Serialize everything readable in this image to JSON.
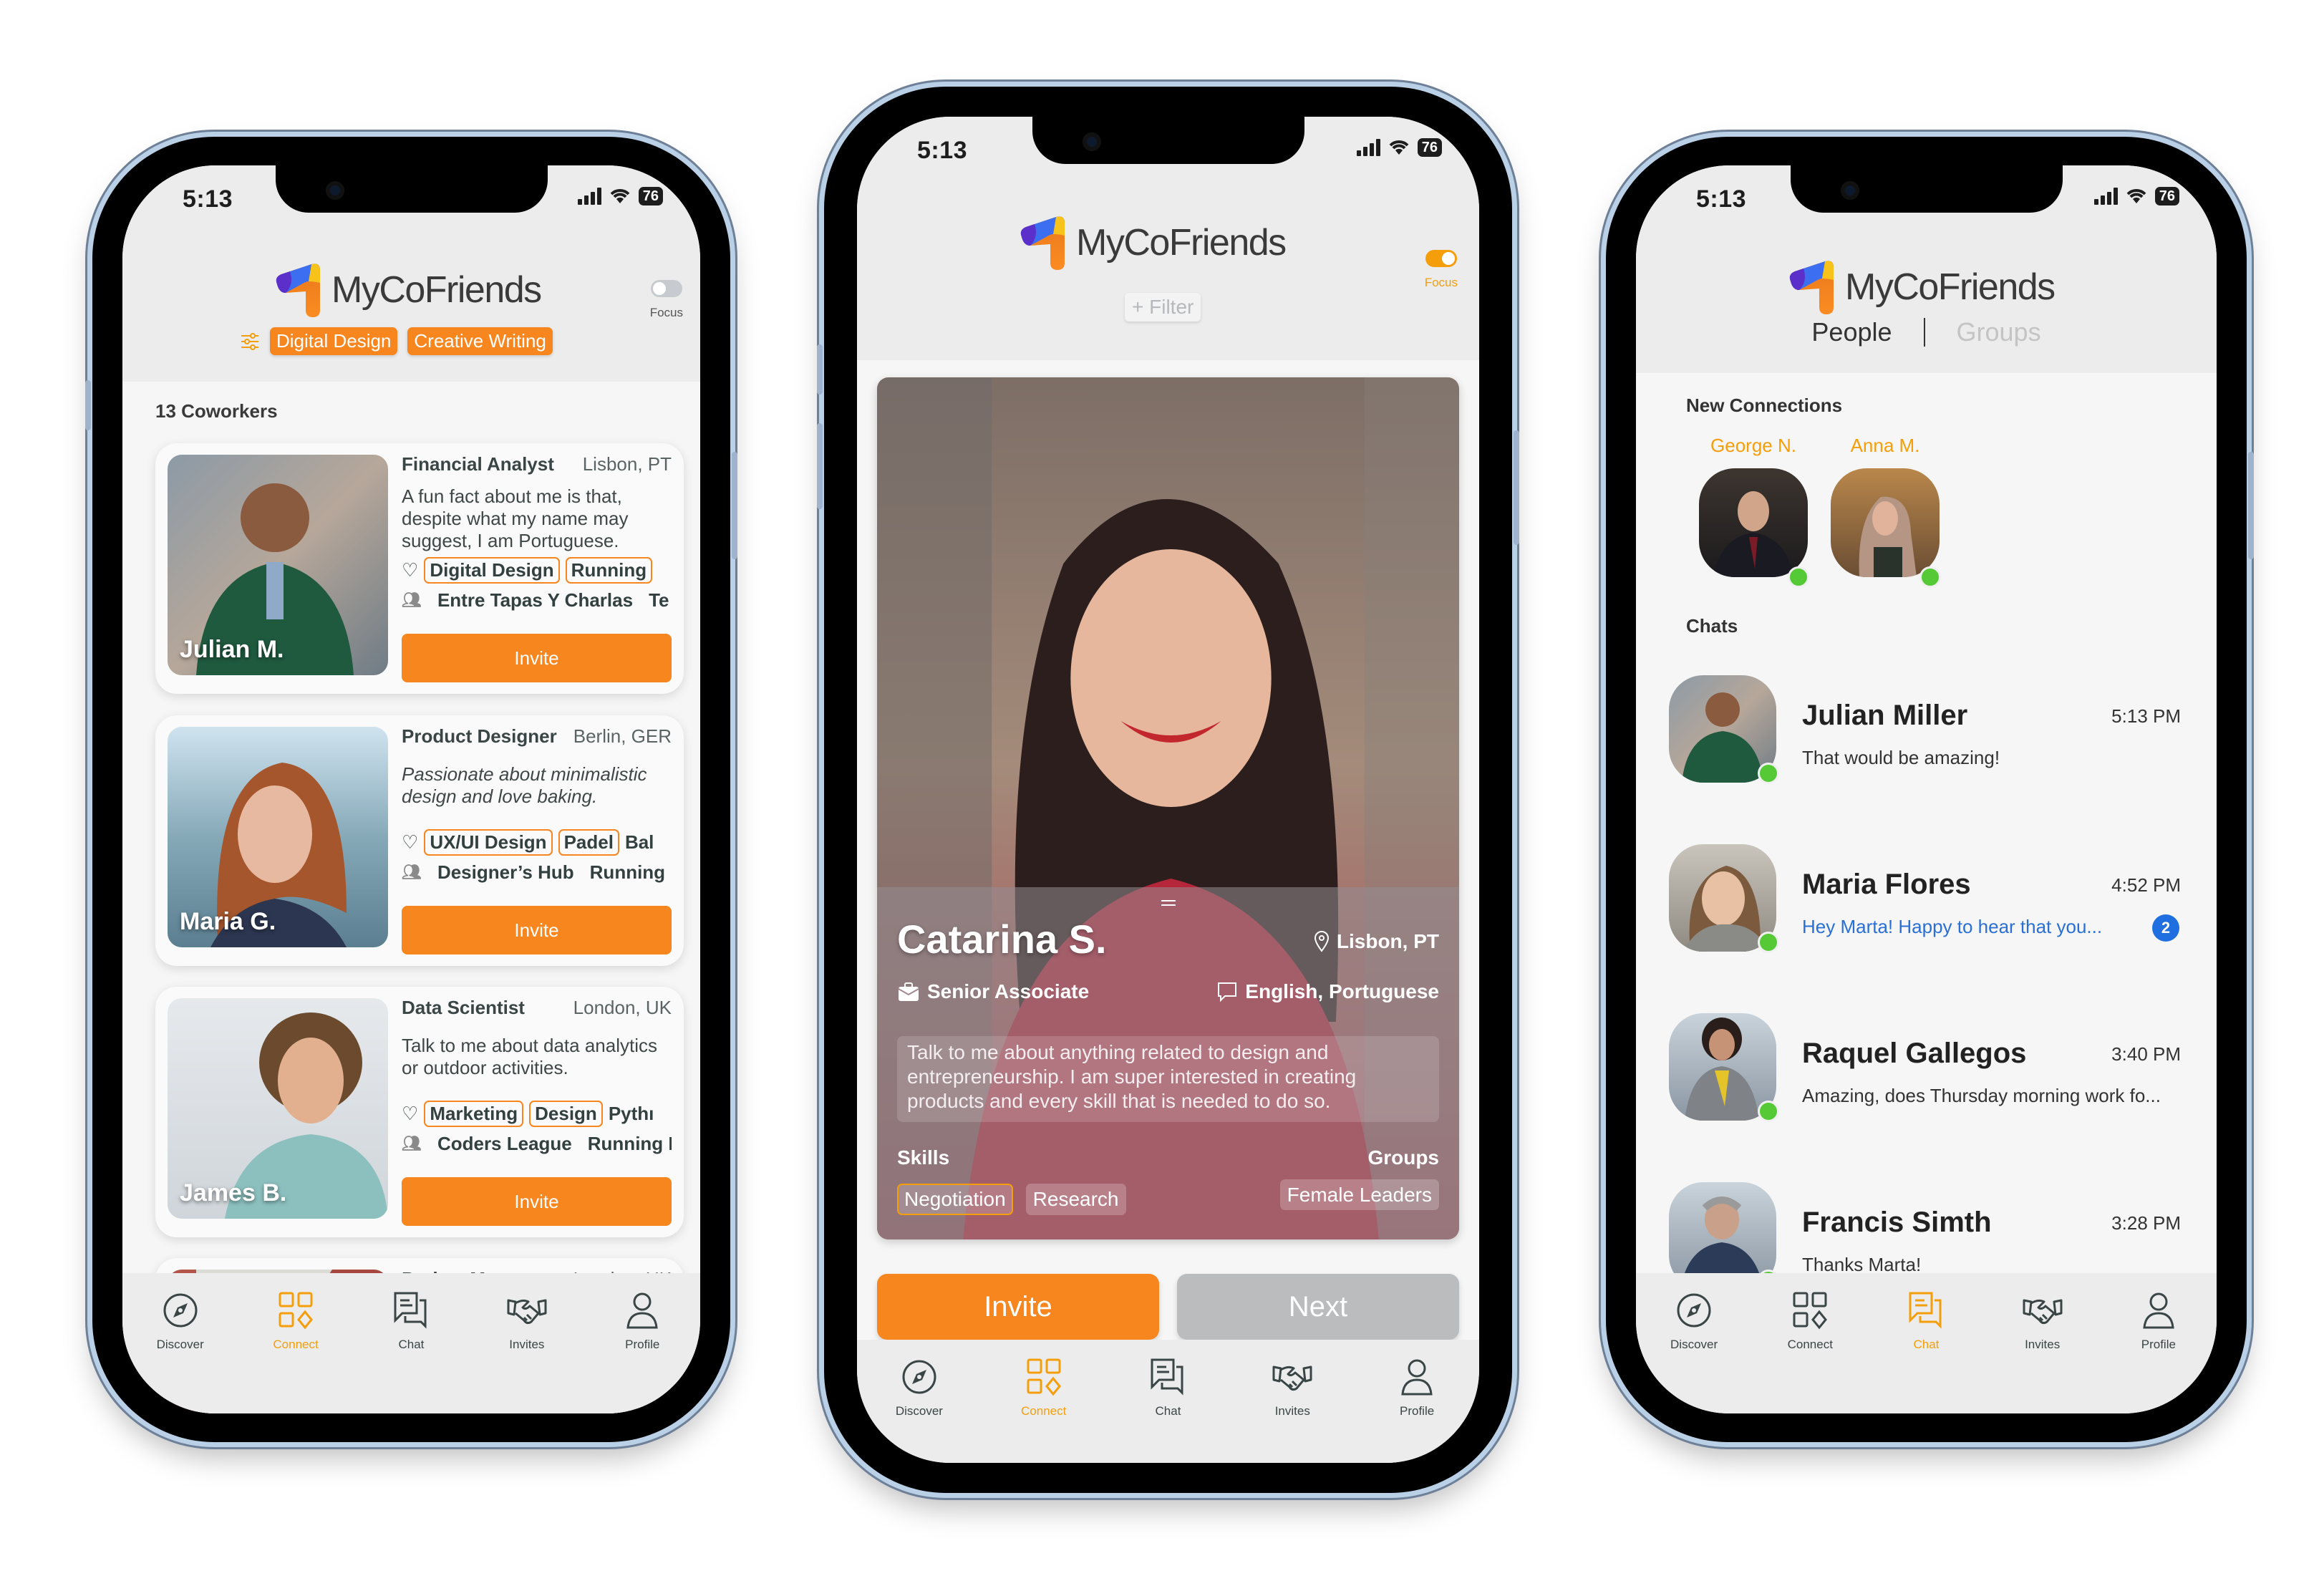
{
  "app": {
    "brand": "MyCoFriends"
  },
  "status_bar": {
    "time": "5:13",
    "battery": "76"
  },
  "nav": {
    "items": [
      {
        "label": "Discover",
        "icon": "compass-icon"
      },
      {
        "label": "Connect",
        "icon": "grid-icon"
      },
      {
        "label": "Chat",
        "icon": "chat-bubbles-icon"
      },
      {
        "label": "Invites",
        "icon": "handshake-icon"
      },
      {
        "label": "Profile",
        "icon": "user-icon"
      }
    ]
  },
  "colors": {
    "accent": "#f7861f",
    "online": "#56c936",
    "unread": "#2a6fd6",
    "secondary_button": "#bbbcbe"
  },
  "phone1": {
    "focus_label": "Focus",
    "focus_on": false,
    "filter_chips": [
      "Digital Design",
      "Creative Writing"
    ],
    "count_label": "13 Coworkers",
    "active_nav": "Connect",
    "cards": [
      {
        "name": "Julian M.",
        "role": "Financial Analyst",
        "location": "Lisbon, PT",
        "bio": "A fun fact about me is that, despite what my name may suggest, I am Portuguese.",
        "interests": [
          "Digital Design",
          "Running"
        ],
        "interests_more": "",
        "groups": [
          "Entre Tapas Y Charlas",
          "Te"
        ],
        "invite": "Invite"
      },
      {
        "name": "Maria G.",
        "role": "Product Designer",
        "location": "Berlin, GER",
        "bio": "Passionate about minimalistic design and love baking.",
        "interests": [
          "UX/UI Design",
          "Padel"
        ],
        "interests_more": "Bal",
        "groups": [
          "Designer’s Hub",
          "Running I"
        ],
        "invite": "Invite"
      },
      {
        "name": "James B.",
        "role": "Data Scientist",
        "location": "London, UK",
        "bio": "Talk to me about data analytics or outdoor activities.",
        "interests": [
          "Marketing",
          "Design"
        ],
        "interests_more": "Pythı",
        "groups": [
          "Coders League",
          "Running I"
        ],
        "invite": "Invite"
      },
      {
        "name": "",
        "role": "Project Manager",
        "location": "London, UK"
      }
    ]
  },
  "phone2": {
    "focus_label": "Focus",
    "focus_on": true,
    "filter_button": "+ Filter",
    "active_nav": "Connect",
    "profile": {
      "name": "Catarina S.",
      "location": "Lisbon, PT",
      "role": "Senior Associate",
      "languages": "English, Portuguese",
      "bio": "Talk to me about anything related to design and entrepreneurship. I am super interested in creating products and every skill that is needed to do so.",
      "skills_label": "Skills",
      "groups_label": "Groups",
      "skills": [
        "Negotiation",
        "Research"
      ],
      "groups": [
        "Female Leaders"
      ]
    },
    "invite_button": "Invite",
    "next_button": "Next"
  },
  "phone3": {
    "tabs": [
      "People",
      "Groups"
    ],
    "active_tab": "People",
    "new_connections_label": "New Connections",
    "new_connections": [
      {
        "name": "George N.",
        "online": true
      },
      {
        "name": "Anna M.",
        "online": true
      }
    ],
    "chats_label": "Chats",
    "active_nav": "Chat",
    "chats": [
      {
        "name": "Julian Miller",
        "time": "5:13 PM",
        "message": "That would be amazing!",
        "unread": 0,
        "online": true
      },
      {
        "name": "Maria Flores",
        "time": "4:52 PM",
        "message": "Hey Marta! Happy to hear that you...",
        "unread": 2,
        "online": true
      },
      {
        "name": "Raquel Gallegos",
        "time": "3:40 PM",
        "message": "Amazing, does Thursday morning work fo...",
        "unread": 0,
        "online": true
      },
      {
        "name": "Francis Simth",
        "time": "3:28 PM",
        "message": "Thanks Marta!",
        "unread": 0,
        "online": true
      }
    ]
  }
}
